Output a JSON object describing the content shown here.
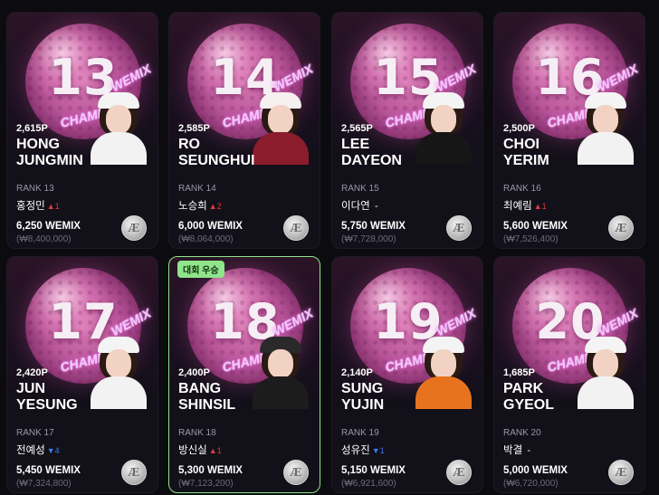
{
  "cards": [
    {
      "rank_num": "13",
      "points": "2,615P",
      "name_line1": "HONG",
      "name_line2": "JUNGMIN",
      "rank_label": "RANK 13",
      "korean_name": "홍정민",
      "change": "▲1",
      "price": "6,250 WEMIX",
      "krw": "(₩8,400,000)",
      "badge": ""
    },
    {
      "rank_num": "14",
      "points": "2,585P",
      "name_line1": "RO",
      "name_line2": "SEUNGHUI",
      "rank_label": "RANK 14",
      "korean_name": "노승희",
      "change": "▲2",
      "price": "6,000 WEMIX",
      "krw": "(₩8,064,000)",
      "badge": ""
    },
    {
      "rank_num": "15",
      "points": "2,565P",
      "name_line1": "LEE",
      "name_line2": "DAYEON",
      "rank_label": "RANK 15",
      "korean_name": "이다연",
      "change": "-",
      "price": "5,750 WEMIX",
      "krw": "(₩7,728,000)",
      "badge": ""
    },
    {
      "rank_num": "16",
      "points": "2,500P",
      "name_line1": "CHOI",
      "name_line2": "YERIM",
      "rank_label": "RANK 16",
      "korean_name": "최예림",
      "change": "▲1",
      "price": "5,600 WEMIX",
      "krw": "(₩7,526,400)",
      "badge": ""
    },
    {
      "rank_num": "17",
      "points": "2,420P",
      "name_line1": "JUN",
      "name_line2": "YESUNG",
      "rank_label": "RANK 17",
      "korean_name": "전예성",
      "change": "▼4",
      "price": "5,450 WEMIX",
      "krw": "(₩7,324,800)",
      "badge": ""
    },
    {
      "rank_num": "18",
      "points": "2,400P",
      "name_line1": "BANG",
      "name_line2": "SHINSIL",
      "rank_label": "RANK 18",
      "korean_name": "방신실",
      "change": "▲1",
      "price": "5,300 WEMIX",
      "krw": "(₩7,123,200)",
      "badge": "대회 우승"
    },
    {
      "rank_num": "19",
      "points": "2,140P",
      "name_line1": "SUNG",
      "name_line2": "YUJIN",
      "rank_label": "RANK 19",
      "korean_name": "성유진",
      "change": "▼1",
      "price": "5,150 WEMIX",
      "krw": "(₩6,921,600)",
      "badge": ""
    },
    {
      "rank_num": "20",
      "points": "1,685P",
      "name_line1": "PARK",
      "name_line2": "GYEOL",
      "rank_label": "RANK 20",
      "korean_name": "박결",
      "change": "-",
      "price": "5,000 WEMIX",
      "krw": "(₩6,720,000)",
      "badge": ""
    }
  ],
  "ball_text": {
    "wemix": "WEMIX",
    "champ": "CHAMP"
  },
  "coin_glyph": "Æ",
  "colors": {
    "up": "#e23b3b",
    "down": "#3b7bea",
    "badge_bg": "#8fe58a",
    "highlight_border": "#8fe58a"
  },
  "icons": {
    "coin": "wemix-coin-icon",
    "player": "player-portrait"
  }
}
